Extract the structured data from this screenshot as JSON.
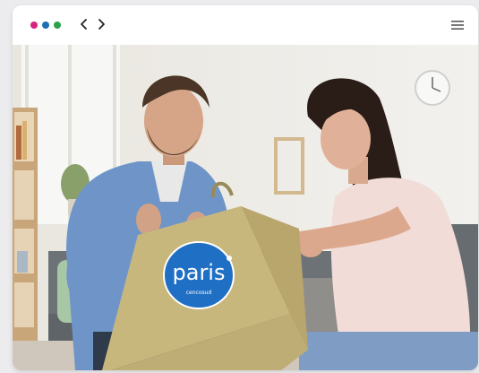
{
  "toolbar": {
    "dots": [
      "#d6237d",
      "#1c6fb4",
      "#2aa248"
    ],
    "back_icon": "chevron-left-icon",
    "forward_icon": "chevron-right-icon",
    "menu_icon": "hamburger-menu-icon"
  },
  "photo": {
    "bag_logo": {
      "brand": "paris",
      "sub": "cencosud"
    }
  }
}
